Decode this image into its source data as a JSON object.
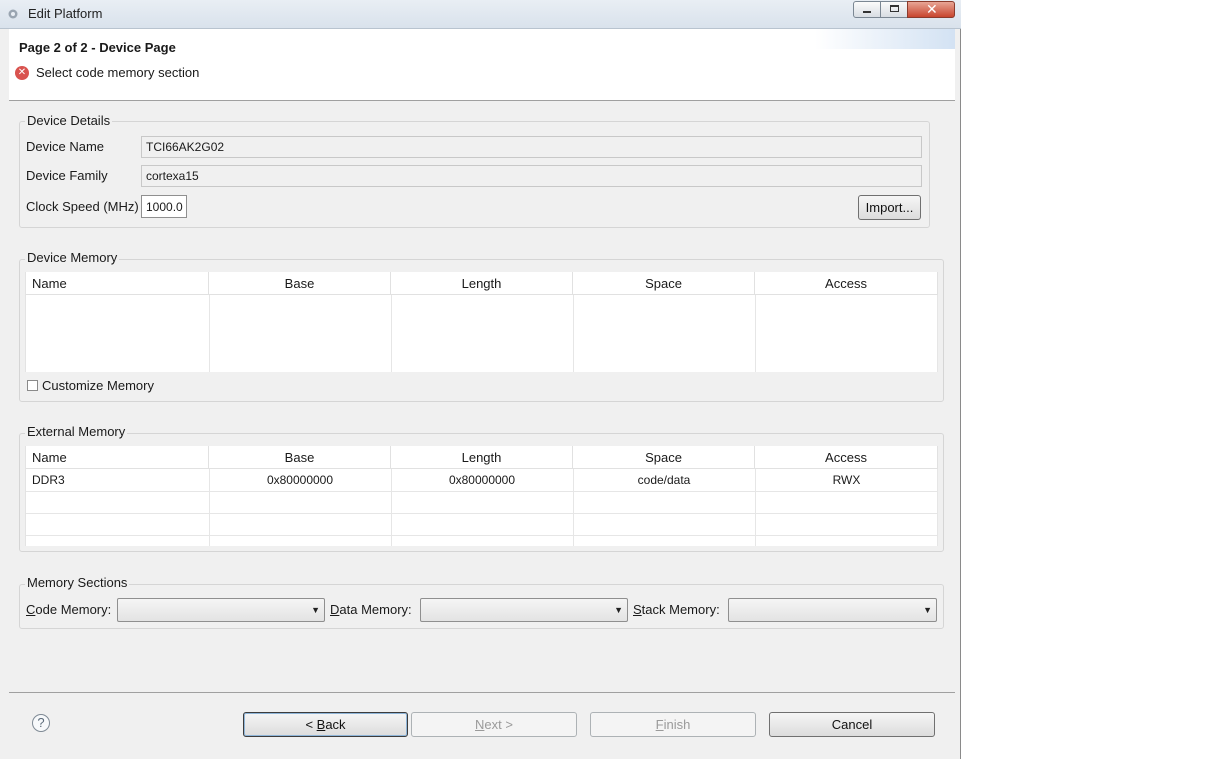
{
  "window": {
    "title": "Edit Platform",
    "close_glyph": "✕"
  },
  "banner": {
    "page_title": "Page 2 of 2 - Device Page",
    "error_icon_glyph": "✕",
    "error_message": "Select code memory section",
    "error_color": "#d9534f"
  },
  "device_details": {
    "group_title": "Device Details",
    "device_name_label": "Device Name",
    "device_name_value": "TCI66AK2G02",
    "device_family_label": "Device Family",
    "device_family_value": "cortexa15",
    "clock_speed_label": "Clock Speed (MHz)",
    "clock_speed_value": "1000.0",
    "import_button": "Import..."
  },
  "device_memory": {
    "group_title": "Device Memory",
    "columns": [
      "Name",
      "Base",
      "Length",
      "Space",
      "Access"
    ],
    "rows": [],
    "customize_label": "Customize Memory",
    "customize_checked": false
  },
  "external_memory": {
    "group_title": "External Memory",
    "columns": [
      "Name",
      "Base",
      "Length",
      "Space",
      "Access"
    ],
    "rows": [
      [
        "DDR3",
        "0x80000000",
        "0x80000000",
        "code/data",
        "RWX"
      ]
    ]
  },
  "memory_sections": {
    "group_title": "Memory Sections",
    "code_memory_mnemonic": "C",
    "code_memory_rest": "ode Memory:",
    "code_memory_value": "",
    "data_memory_mnemonic": "D",
    "data_memory_rest": "ata Memory:",
    "data_memory_value": "",
    "stack_memory_mnemonic": "S",
    "stack_memory_rest": "tack Memory:",
    "stack_memory_value": "",
    "dropdown_glyph": "▼"
  },
  "footer": {
    "help_glyph": "?",
    "back_prefix": "< ",
    "back_mnemonic": "B",
    "back_rest": "ack",
    "next_mnemonic": "N",
    "next_rest": "ext >",
    "finish_mnemonic": "F",
    "finish_rest": "inish",
    "cancel_label": "Cancel"
  }
}
